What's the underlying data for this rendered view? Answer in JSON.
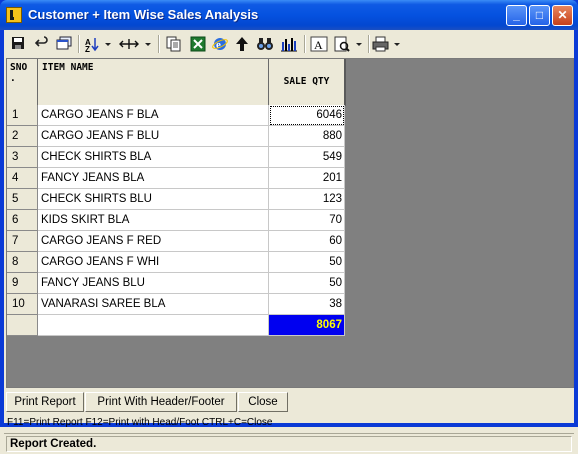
{
  "window": {
    "title": "Customer + Item Wise Sales Analysis"
  },
  "title_buttons": {
    "minimize": "_",
    "maximize": "□",
    "close": "✕"
  },
  "toolbar": {
    "icons": [
      "save-icon",
      "undo-icon",
      "window-icon",
      "sort-icon",
      "column-width-icon",
      "copy-icon",
      "excel-icon",
      "internet-explorer-icon",
      "find-icon",
      "up-arrow-icon",
      "bar-chart-icon",
      "font-icon",
      "print-preview-icon",
      "printer-icon"
    ]
  },
  "grid": {
    "columns": {
      "sno_line1": "SNO",
      "sno_line2": ".",
      "item_name": "ITEM NAME",
      "sale_qty": "SALE QTY"
    },
    "rows": [
      {
        "sno": "1",
        "name": "CARGO JEANS F BLA",
        "qty": "6046"
      },
      {
        "sno": "2",
        "name": "CARGO JEANS F BLU",
        "qty": "880"
      },
      {
        "sno": "3",
        "name": "CHECK SHIRTS BLA",
        "qty": "549"
      },
      {
        "sno": "4",
        "name": "FANCY JEANS BLA",
        "qty": "201"
      },
      {
        "sno": "5",
        "name": "CHECK SHIRTS BLU",
        "qty": "123"
      },
      {
        "sno": "6",
        "name": "KIDS SKIRT BLA",
        "qty": "70"
      },
      {
        "sno": "7",
        "name": "CARGO JEANS F RED",
        "qty": "60"
      },
      {
        "sno": "8",
        "name": "CARGO JEANS F WHI",
        "qty": "50"
      },
      {
        "sno": "9",
        "name": "FANCY JEANS BLU",
        "qty": "50"
      },
      {
        "sno": "10",
        "name": "VANARASI SAREE BLA",
        "qty": "38"
      }
    ],
    "total": {
      "qty": "8067"
    },
    "total_colors": {
      "background": "#0000f0",
      "text": "#ffff00"
    }
  },
  "buttons": {
    "print_report": "Print Report",
    "print_header_footer": "Print With Header/Footer",
    "close": "Close"
  },
  "hint": "F11=Print Report  F12=Print with Head/Foot  CTRL+C=Close",
  "status": "Report Created."
}
